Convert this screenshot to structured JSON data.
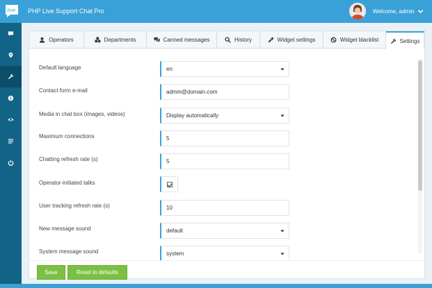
{
  "header": {
    "logo_text": "live",
    "title": "PHP Live Support Chat Pro",
    "welcome": "Welcome, admin"
  },
  "sidebar": {
    "items": [
      {
        "icon": "comment-icon"
      },
      {
        "icon": "map-marker-icon"
      },
      {
        "icon": "wrench-icon",
        "active": true
      },
      {
        "icon": "info-icon"
      },
      {
        "icon": "eye-icon"
      },
      {
        "icon": "list-icon"
      },
      {
        "icon": "power-icon"
      }
    ]
  },
  "tabs": [
    {
      "label": "Operators",
      "icon": "user-icon"
    },
    {
      "label": "Departments",
      "icon": "cubes-icon"
    },
    {
      "label": "Canned messages",
      "icon": "comments-icon"
    },
    {
      "label": "History",
      "icon": "search-icon"
    },
    {
      "label": "Widget settings",
      "icon": "eyedropper-icon"
    },
    {
      "label": "Widget blacklist",
      "icon": "ban-icon"
    },
    {
      "label": "Settings",
      "icon": "wrench-icon",
      "active": true
    }
  ],
  "settings": {
    "default_language": {
      "label": "Default language",
      "value": "en"
    },
    "contact_email": {
      "label": "Contact form e-mail",
      "value": "admin@domain.com"
    },
    "media": {
      "label": "Media in chat box (images, videos)",
      "value": "Display automatically"
    },
    "max_connections": {
      "label": "Maximum connections",
      "value": "5"
    },
    "refresh_rate": {
      "label": "Chatting refresh rate (s)",
      "value": "5"
    },
    "operator_talks": {
      "label": "Operator-initiated talks",
      "checked": true
    },
    "tracking_rate": {
      "label": "User tracking refresh rate (s)",
      "value": "10"
    },
    "new_message_sound": {
      "label": "New message sound",
      "value": "default"
    },
    "system_message_sound": {
      "label": "System message sound",
      "value": "system"
    }
  },
  "actions": {
    "save": "Save",
    "reset": "Reset to defaults"
  },
  "colors": {
    "topbar": "#3aa1d8",
    "sidebar": "#126487",
    "accent": "#3aa1d8",
    "button": "#7cc043"
  }
}
